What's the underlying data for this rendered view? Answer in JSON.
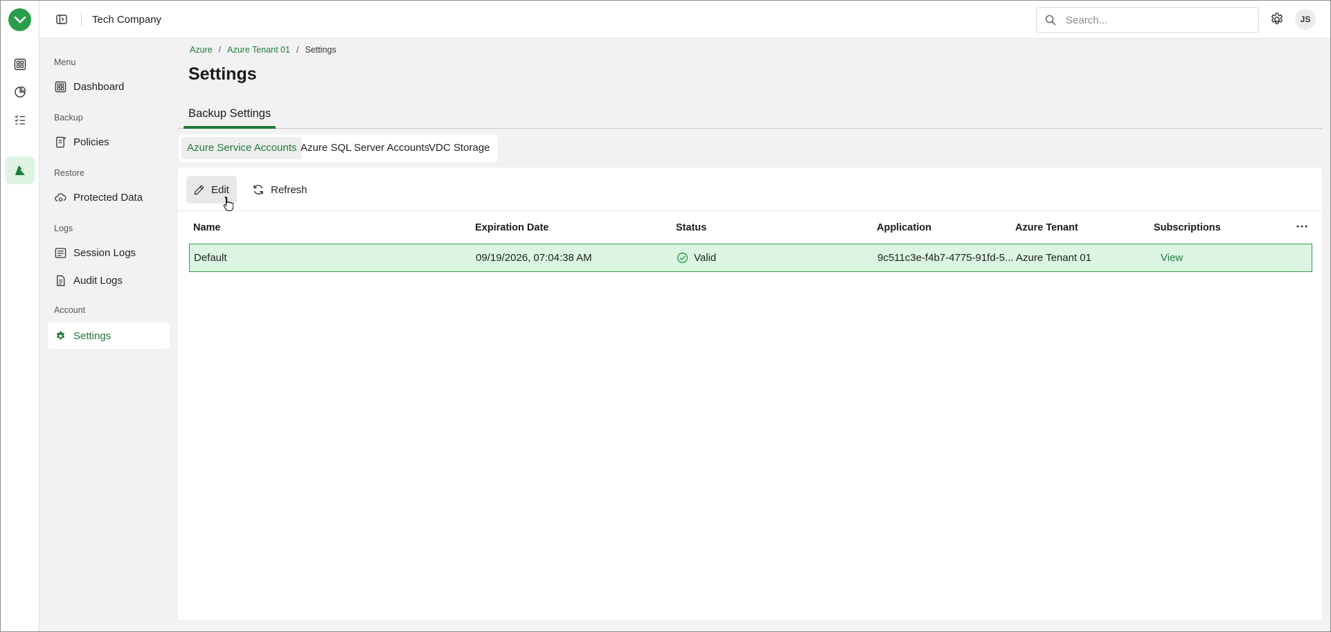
{
  "header": {
    "company": "Tech Company",
    "search_placeholder": "Search...",
    "avatar_initials": "JS"
  },
  "nav": {
    "sections": {
      "menu": "Menu",
      "backup": "Backup",
      "restore": "Restore",
      "logs": "Logs",
      "account": "Account"
    },
    "items": {
      "dashboard": "Dashboard",
      "policies": "Policies",
      "protected_data": "Protected Data",
      "session_logs": "Session Logs",
      "audit_logs": "Audit Logs",
      "settings": "Settings"
    },
    "active_item": "settings"
  },
  "breadcrumb": {
    "items": [
      "Azure",
      "Azure Tenant 01",
      "Settings"
    ],
    "separator": "/"
  },
  "page": {
    "title": "Settings",
    "main_tab": "Backup Settings",
    "sub_tabs": [
      "Azure Service Accounts",
      "Azure SQL Server Accounts",
      "VDC Storage"
    ],
    "active_sub_tab": "Azure Service Accounts"
  },
  "toolbar": {
    "edit_label": "Edit",
    "refresh_label": "Refresh"
  },
  "table": {
    "columns": [
      "Name",
      "Expiration Date",
      "Status",
      "Application",
      "Azure Tenant",
      "Subscriptions"
    ],
    "rows": [
      {
        "name": "Default",
        "expiration_date": "09/19/2026, 07:04:38 AM",
        "status": "Valid",
        "application": "9c511c3e-f4b7-4775-91fd-5...",
        "azure_tenant": "Azure Tenant 01",
        "subscriptions": "View",
        "selected": true
      }
    ]
  },
  "colors": {
    "brand_green": "#2a9d4a",
    "accent_green": "#1f7a3a",
    "selected_row_bg": "#dbf5e2",
    "selected_row_border": "#2f9a4c"
  },
  "icons": {
    "rail": [
      "veeam-logo-icon",
      "dashboard-icon",
      "reports-icon",
      "tasks-icon",
      "azure-icon"
    ]
  }
}
